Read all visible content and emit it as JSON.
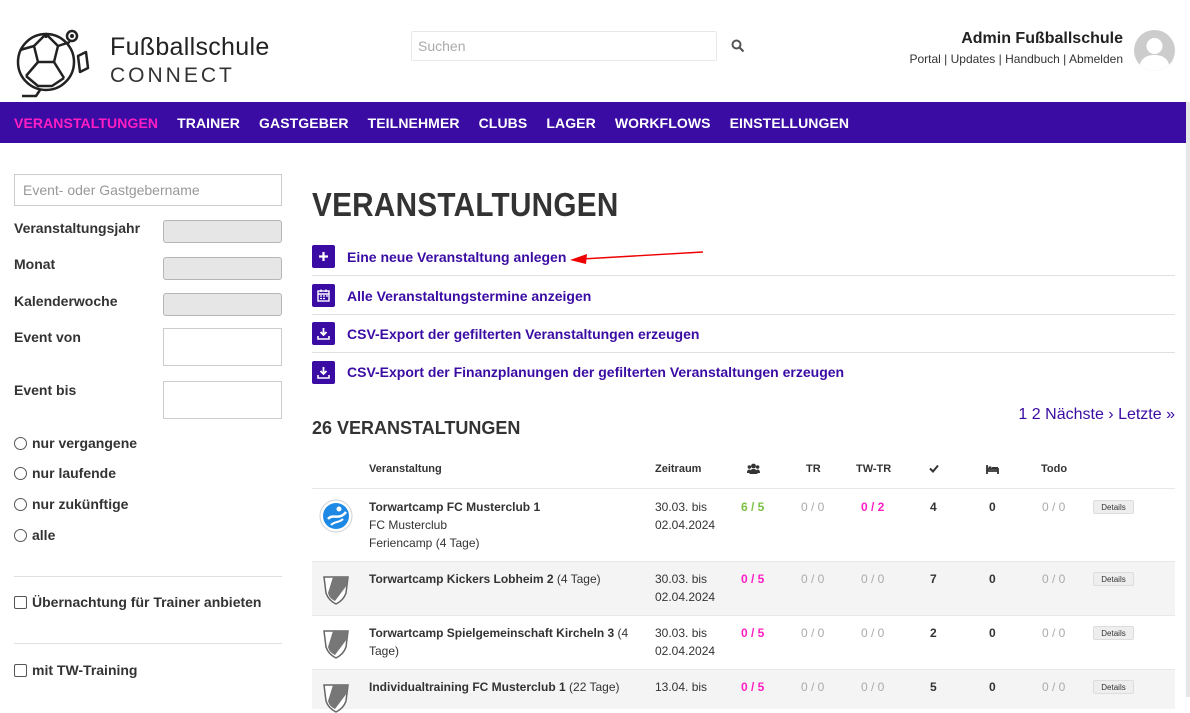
{
  "header": {
    "brand_title": "Fußballschule",
    "brand_sub": "CONNECT",
    "search_placeholder": "Suchen",
    "user_name": "Admin Fußballschule",
    "links": [
      "Portal",
      "Updates",
      "Handbuch",
      "Abmelden"
    ],
    "separator": " | "
  },
  "nav": {
    "items": [
      "VERANSTALTUNGEN",
      "TRAINER",
      "GASTGEBER",
      "TEILNEHMER",
      "CLUBS",
      "LAGER",
      "WORKFLOWS",
      "EINSTELLUNGEN"
    ],
    "active_index": 0
  },
  "sidebar": {
    "search_placeholder": "Event- oder Gastgebername",
    "year_label": "Veranstaltungsjahr",
    "month_label": "Monat",
    "week_label": "Kalenderwoche",
    "from_label": "Event von",
    "to_label": "Event bis",
    "radios": [
      "nur vergangene",
      "nur laufende",
      "nur zukünftige",
      "alle"
    ],
    "check1": "Übernachtung für Trainer anbieten",
    "check2": "mit TW-Training"
  },
  "main": {
    "title": "VERANSTALTUNGEN",
    "actions": [
      {
        "label": "Eine neue Veranstaltung anlegen",
        "icon": "plus-icon"
      },
      {
        "label": "Alle Veranstaltungstermine anzeigen",
        "icon": "calendar-icon"
      },
      {
        "label": "CSV-Export der gefilterten Veranstaltungen erzeugen",
        "icon": "download-icon"
      },
      {
        "label": "CSV-Export der Finanzplanungen der gefilterten Veranstaltungen erzeugen",
        "icon": "download-icon"
      }
    ],
    "count_title": "26 VERANSTALTUNGEN",
    "pager": {
      "p1": "1",
      "p2": "2",
      "next": "Nächste ›",
      "last": "Letzte »"
    }
  },
  "table": {
    "headers": {
      "event": "Veranstaltung",
      "period": "Zeitraum",
      "participants_icon": "group-icon",
      "tr": "TR",
      "twtr": "TW-TR",
      "check_icon": "check-icon",
      "bed_icon": "bed-icon",
      "todo": "Todo"
    },
    "details_label": "Details",
    "rows": [
      {
        "name": "Torwartcamp FC Musterclub 1",
        "suffix": "",
        "line2": "FC Musterclub",
        "line3": "Feriencamp (4 Tage)",
        "from": "30.03. bis",
        "to": "02.04.2024",
        "participants": "6 / 5",
        "tr": "0 / 0",
        "twtr": "0 / 2",
        "check": "4",
        "bed": "0",
        "todo": "0 / 0"
      },
      {
        "name": "Torwartcamp Kickers Lobheim 2",
        "suffix": " (4 Tage)",
        "line2": "",
        "line3": "",
        "from": "30.03. bis",
        "to": "02.04.2024",
        "participants": "0 / 5",
        "tr": "0 / 0",
        "twtr": "0 / 0",
        "check": "7",
        "bed": "0",
        "todo": "0 / 0"
      },
      {
        "name": "Torwartcamp Spielgemeinschaft Kircheln 3",
        "suffix": " (4",
        "line2": "Tage)",
        "line3": "",
        "from": "30.03. bis",
        "to": "02.04.2024",
        "participants": "0 / 5",
        "tr": "0 / 0",
        "twtr": "0 / 0",
        "check": "2",
        "bed": "0",
        "todo": "0 / 0"
      },
      {
        "name": "Individualtraining FC Musterclub 1",
        "suffix": " (22 Tage)",
        "line2": "",
        "line3": "",
        "from": "13.04. bis",
        "to": "",
        "participants": "0 / 5",
        "tr": "0 / 0",
        "twtr": "0 / 0",
        "check": "5",
        "bed": "0",
        "todo": "0 / 0"
      }
    ]
  },
  "colors": {
    "brand": "#3a0ca3",
    "active_nav": "#ff1ec3",
    "green": "#7bc143",
    "pink": "#ff1ec3"
  }
}
